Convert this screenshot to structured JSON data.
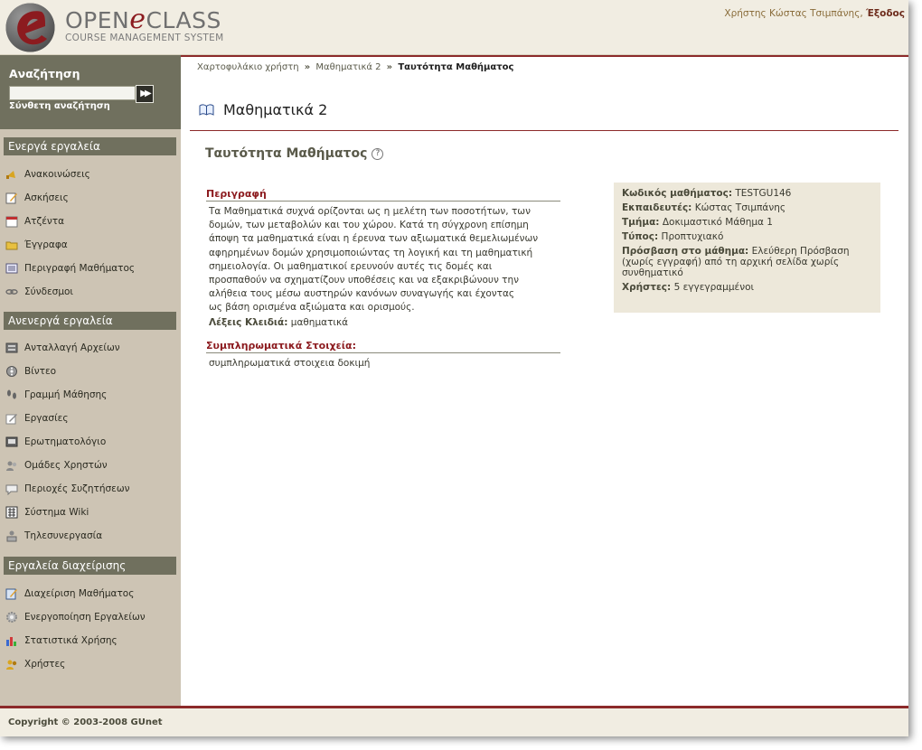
{
  "header": {
    "logo_main_pre": "OPEN",
    "logo_main_e": "e",
    "logo_main_post": "CLASS",
    "logo_sub": "COURSE MANAGEMENT SYSTEM",
    "user_text": "Χρήστης Κώστας Τσιμπάνης,",
    "logout": "Έξοδος"
  },
  "search": {
    "title": "Αναζήτηση",
    "placeholder": "",
    "go_symbol": "▶▶",
    "advanced": "Σύνθετη αναζήτηση"
  },
  "sidebar": {
    "active_title": "Ενεργά εργαλεία",
    "active_items": [
      {
        "label": "Ανακοινώσεις",
        "icon": "megaphone-icon"
      },
      {
        "label": "Ασκήσεις",
        "icon": "pencil-paper-icon"
      },
      {
        "label": "Ατζέντα",
        "icon": "calendar-icon"
      },
      {
        "label": "Έγγραφα",
        "icon": "folder-icon"
      },
      {
        "label": "Περιγραφή Μαθήματος",
        "icon": "list-icon"
      },
      {
        "label": "Σύνδεσμοι",
        "icon": "link-icon"
      }
    ],
    "inactive_title": "Ανενεργά εργαλεία",
    "inactive_items": [
      {
        "label": "Ανταλλαγή Αρχείων",
        "icon": "file-exchange-icon"
      },
      {
        "label": "Βίντεο",
        "icon": "film-reel-icon"
      },
      {
        "label": "Γραμμή Μάθησης",
        "icon": "footprints-icon"
      },
      {
        "label": "Εργασίες",
        "icon": "assignment-icon"
      },
      {
        "label": "Ερωτηματολόγιο",
        "icon": "questionnaire-icon"
      },
      {
        "label": "Ομάδες Χρηστών",
        "icon": "user-group-icon"
      },
      {
        "label": "Περιοχές Συζητήσεων",
        "icon": "speech-bubble-icon"
      },
      {
        "label": "Σύστημα Wiki",
        "icon": "wiki-icon"
      },
      {
        "label": "Τηλεσυνεργασία",
        "icon": "conference-icon"
      }
    ],
    "admin_title": "Εργαλεία διαχείρισης",
    "admin_items": [
      {
        "label": "Διαχείριση Μαθήματος",
        "icon": "course-admin-icon"
      },
      {
        "label": "Ενεργοποίηση Εργαλείων",
        "icon": "gear-icon"
      },
      {
        "label": "Στατιστικά Χρήσης",
        "icon": "bar-chart-icon"
      },
      {
        "label": "Χρήστες",
        "icon": "users-icon"
      }
    ]
  },
  "breadcrumb": {
    "item1": "Χαρτοφυλάκιο χρήστη",
    "sep": "»",
    "item2": "Μαθηματικά 2",
    "current": "Ταυτότητα Μαθήματος"
  },
  "main": {
    "course_title": "Μαθηματικά 2",
    "heading": "Ταυτότητα Μαθήματος",
    "help_symbol": "?",
    "description_label": "Περιγραφή",
    "description_lines": [
      "Τα Μαθηματικά συχνά ορίζονται ως η μελέτη των ποσοτήτων, των",
      "δομών, των μεταβολών και του χώρου. Κατά τη σύγχρονη επίσημη",
      "άποψη τα μαθηματικά είναι η έρευνα των αξιωματικά θεμελιωμένων",
      "αφηρημένων δομών χρησιμοποιώντας τη λογική και τη μαθηματική",
      "σημειολογία. Οι μαθηματικοί ερευνούν αυτές τις δομές και",
      "προσπαθούν να σχηματίζουν υποθέσεις και να εξακριβώνουν την",
      "αλήθεια τους μέσω αυστηρών κανόνων συναγωγής και έχοντας",
      "ως βάση ορισμένα αξιώματα και ορισμούς."
    ],
    "keywords_label": "Λέξεις Κλειδιά:",
    "keywords_value": "μαθηματικά",
    "extra_label": "Συμπληρωματικά Στοιχεία:",
    "extra_value": "συμπληρωματικά στοιχεια δοκιμή"
  },
  "info": {
    "code_label": "Κωδικός μαθήματος:",
    "code_value": "TESTGU146",
    "teachers_label": "Εκπαιδευτές:",
    "teachers_value": "Κώστας Τσιμπάνης",
    "dept_label": "Τμήμα:",
    "dept_value": "Δοκιμαστικό Μάθημα 1",
    "type_label": "Τύπος:",
    "type_value": "Προπτυχιακό",
    "access_label": "Πρόσβαση στο μάθημα:",
    "access_value": "Ελεύθερη Πρόσβαση (χωρίς εγγραφή) από τη αρχική σελίδα χωρίς συνθηματικό",
    "users_label": "Χρήστες:",
    "users_value": "5 εγγεγραμμένοι"
  },
  "footer": {
    "copyright": "Copyright © 2003-2008 GUnet"
  },
  "colors": {
    "accent": "#8c2a2a",
    "sidebar_bg": "#cdc4b4",
    "section_bg": "#70705e",
    "header_bg": "#f1ede2",
    "info_bg": "#ede8da"
  }
}
